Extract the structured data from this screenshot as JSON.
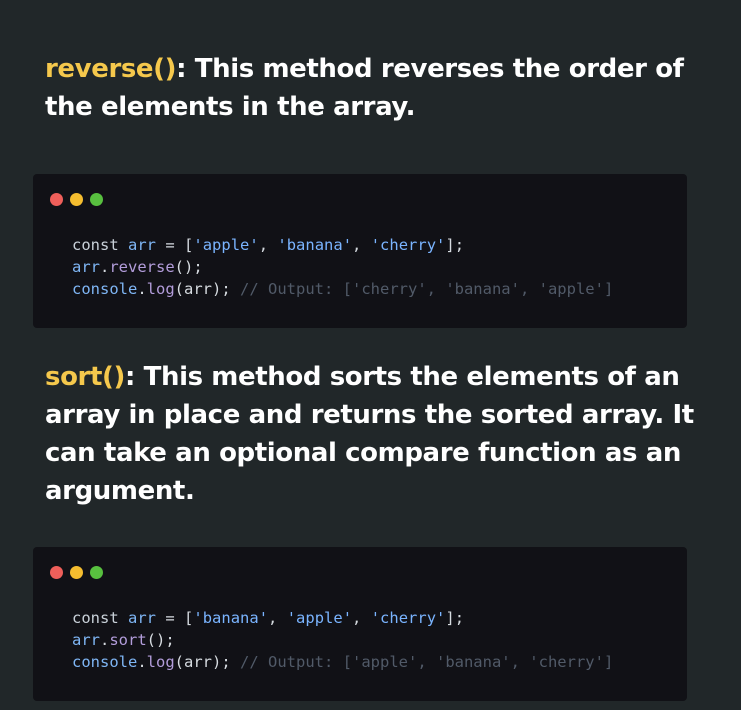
{
  "sections": [
    {
      "method": "reverse()",
      "description": ": This method reverses the order of the elements in the array.",
      "code": {
        "line1": {
          "kw": "const",
          "var": "arr",
          "eq": "=",
          "open": "[",
          "items": [
            "'apple'",
            "'banana'",
            "'cherry'"
          ],
          "close": "];"
        },
        "line2": {
          "obj": "arr",
          "dot": ".",
          "method": "reverse",
          "call": "();"
        },
        "line3": {
          "obj": "console",
          "dot": ".",
          "method": "log",
          "call": "(arr);",
          "comment": "// Output: ['cherry', 'banana', 'apple']"
        }
      }
    },
    {
      "method": "sort()",
      "description": ": This method sorts the elements of an array in place and returns the sorted array. It can take an optional compare function as an argument.",
      "code": {
        "line1": {
          "kw": "const",
          "var": "arr",
          "eq": "=",
          "open": "[",
          "items": [
            "'banana'",
            "'apple'",
            "'cherry'"
          ],
          "close": "];"
        },
        "line2": {
          "obj": "arr",
          "dot": ".",
          "method": "sort",
          "call": "();"
        },
        "line3": {
          "obj": "console",
          "dot": ".",
          "method": "log",
          "call": "(arr);",
          "comment": "// Output: ['apple', 'banana', 'cherry']"
        }
      }
    }
  ],
  "colors": {
    "background": "#212729",
    "method_highlight": "#f5c84c",
    "code_bg": "#111116"
  }
}
